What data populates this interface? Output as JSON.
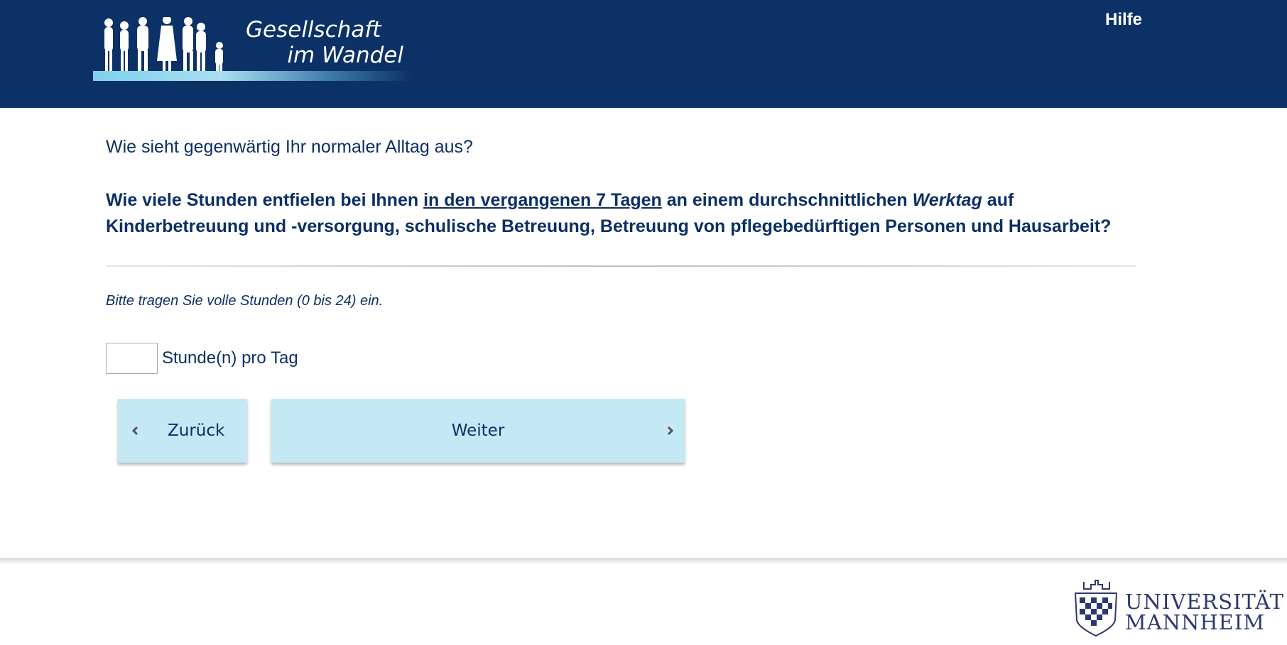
{
  "header": {
    "logo_line1": "Gesellschaft",
    "logo_line2": "im Wandel",
    "help_label": "Hilfe"
  },
  "main": {
    "intro": "Wie sieht gegenwärtig Ihr normaler Alltag aus?",
    "question_part1": "Wie viele Stunden entfielen bei Ihnen ",
    "question_underlined": "in den vergangenen 7 Tagen",
    "question_part2": " an einem durchschnittlichen ",
    "question_italic": "Werktag",
    "question_part3": " auf Kinderbetreuung und -versorgung, schulische Betreuung, Betreuung von pflegebedürftigen Personen und Hausarbeit?",
    "instruction": "Bitte tragen Sie volle Stunden (0 bis 24) ein.",
    "hours_value": "",
    "unit_label": "Stunde(n) pro Tag"
  },
  "nav": {
    "back_label": "Zurück",
    "next_label": "Weiter"
  },
  "footer": {
    "uni_line1": "UNIVERSITÄT",
    "uni_line2": "MANNHEIM"
  },
  "colors": {
    "header_bg": "#0b3166",
    "text": "#0c2f66",
    "button_bg": "#c5e8f5"
  },
  "icons": {
    "back": "chevron-left-icon",
    "next": "chevron-right-icon"
  }
}
